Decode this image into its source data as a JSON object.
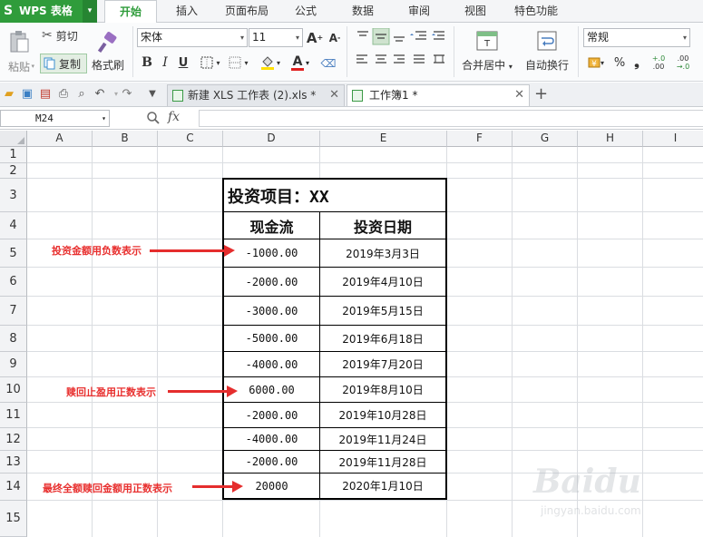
{
  "app": {
    "logo_glyph": "S",
    "logo_text": "WPS 表格",
    "logo_menu_arrow": "▾"
  },
  "menu_tabs": [
    {
      "label": "开始",
      "active": true
    },
    {
      "label": "插入"
    },
    {
      "label": "页面布局"
    },
    {
      "label": "公式"
    },
    {
      "label": "数据"
    },
    {
      "label": "审阅"
    },
    {
      "label": "视图"
    },
    {
      "label": "特色功能"
    }
  ],
  "ribbon": {
    "paste_label": "粘贴",
    "cut_label": "剪切",
    "copy_label": "复制",
    "format_painter_label": "格式刷",
    "font_name": "宋体",
    "font_size": "11",
    "bold": "B",
    "italic": "I",
    "underline": "U",
    "font_color_glyph": "A",
    "grow_font": "A",
    "shrink_font": "A",
    "merge_center_label": "合并居中",
    "wrap_text_label": "自动换行",
    "number_format": "常规",
    "percent": "%",
    "comma": "❟",
    "inc_decimal_top": "+.0",
    "inc_decimal_bottom": ".00",
    "dec_decimal_top": ".00",
    "dec_decimal_bottom": "→.0",
    "merge_icon_glyph": "T",
    "accent_color": "#2f9c3b",
    "font_color": "#e02020",
    "highlight_color": "#ffe000"
  },
  "doc_tabs": [
    {
      "label": "新建 XLS 工作表 (2).xls *",
      "active": false
    },
    {
      "label": "工作簿1 *",
      "active": true
    }
  ],
  "new_tab_glyph": "+",
  "close_glyph": "✕",
  "formula_bar": {
    "cell_ref": "M24",
    "zoom_icon": "🔍",
    "fx_label": "fx",
    "value": ""
  },
  "columns": [
    "A",
    "B",
    "C",
    "D",
    "E",
    "F",
    "G",
    "H",
    "I"
  ],
  "rows": [
    "1",
    "2",
    "3",
    "4",
    "5",
    "6",
    "7",
    "8",
    "9",
    "10",
    "11",
    "12",
    "13",
    "14",
    "15"
  ],
  "table": {
    "title": "投资项目：XX",
    "headers": [
      "现金流",
      "投资日期"
    ],
    "rows": [
      [
        "-1000.00",
        "2019年3月3日"
      ],
      [
        "-2000.00",
        "2019年4月10日"
      ],
      [
        "-3000.00",
        "2019年5月15日"
      ],
      [
        "-5000.00",
        "2019年6月18日"
      ],
      [
        "-4000.00",
        "2019年7月20日"
      ],
      [
        "6000.00",
        "2019年8月10日"
      ],
      [
        "-2000.00",
        "2019年10月28日"
      ],
      [
        "-4000.00",
        "2019年11月24日"
      ],
      [
        "-2000.00",
        "2019年11月28日"
      ],
      [
        "20000",
        "2020年1月10日"
      ]
    ]
  },
  "annotations": [
    {
      "text": "投资金额用负数表示"
    },
    {
      "text": "赎回止盈用正数表示"
    },
    {
      "text": "最终全额赎回金额用正数表示"
    }
  ],
  "watermark": {
    "brand": "Baidu",
    "sub": "jingyan.baidu.com"
  }
}
